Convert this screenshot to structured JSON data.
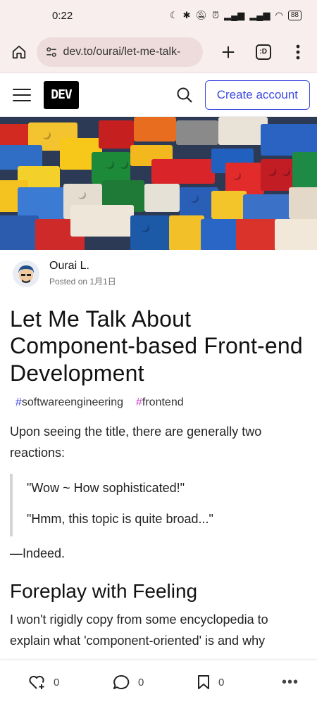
{
  "status": {
    "time": "0:22",
    "battery": "88"
  },
  "browser": {
    "url": "dev.to/ourai/let-me-talk-",
    "tabs_count": ":D"
  },
  "header": {
    "logo": "DEV",
    "create_account": "Create account"
  },
  "author": {
    "name": "Ourai L.",
    "posted": "Posted on 1月1日"
  },
  "article": {
    "title": "Let Me Talk About Component-based Front-end Development",
    "tags": [
      {
        "hash": "#",
        "name": "softwareengineering",
        "color": "#3b49df"
      },
      {
        "hash": "#",
        "name": "frontend",
        "color": "#c840c8"
      }
    ],
    "intro": "Upon seeing the title, there are generally two reactions:",
    "quotes": [
      "\"Wow ~ How sophisticated!\"",
      "\"Hmm, this topic is quite broad...\""
    ],
    "indeed": "—Indeed.",
    "section_heading": "Foreplay with Feeling",
    "section_para": "I won't rigidly copy from some encyclopedia to explain what 'component-oriented' is and why"
  },
  "actions": {
    "reactions": "0",
    "comments": "0",
    "bookmarks": "0",
    "more": "•••"
  },
  "colors": {
    "accent": "#3b49df",
    "browser_bg": "#f9eeee"
  }
}
